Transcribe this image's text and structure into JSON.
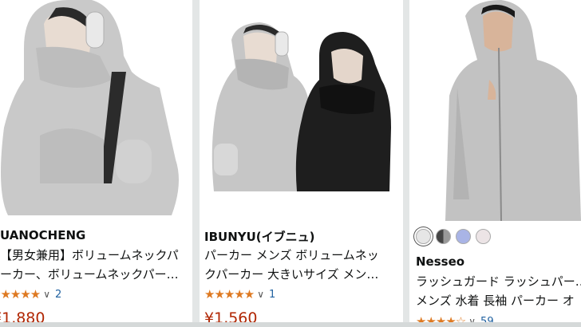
{
  "products": [
    {
      "brand": "UANOCHENG",
      "title_line1": "【男女兼用】ボリュームネックパ",
      "title_line2": "ーカー、ボリュームネックパーカー…",
      "rating_count": "2",
      "rating_stars": 5,
      "price": "¥1,880"
    },
    {
      "brand": "IBUNYU(イブニュ)",
      "title_line1": "パーカー メンズ ボリュームネッ",
      "title_line2": "クパーカー 大きいサイズ メン…",
      "rating_count": "1",
      "rating_stars": 5,
      "price": "¥1,560"
    },
    {
      "brand": "Nesseo",
      "title_line1": "ラッシュガード ラッシュパーカー",
      "title_line2": "メンズ 水着 長袖 パーカー オ",
      "rating_count": "59",
      "rating_stars": 4,
      "swatch_colors": [
        "#e6e6e6",
        "#555555",
        "#a9b4e6",
        "#ece4e6"
      ]
    }
  ],
  "colors": {
    "star": "#de7921",
    "price": "#b12704",
    "link": "#2162a1"
  }
}
